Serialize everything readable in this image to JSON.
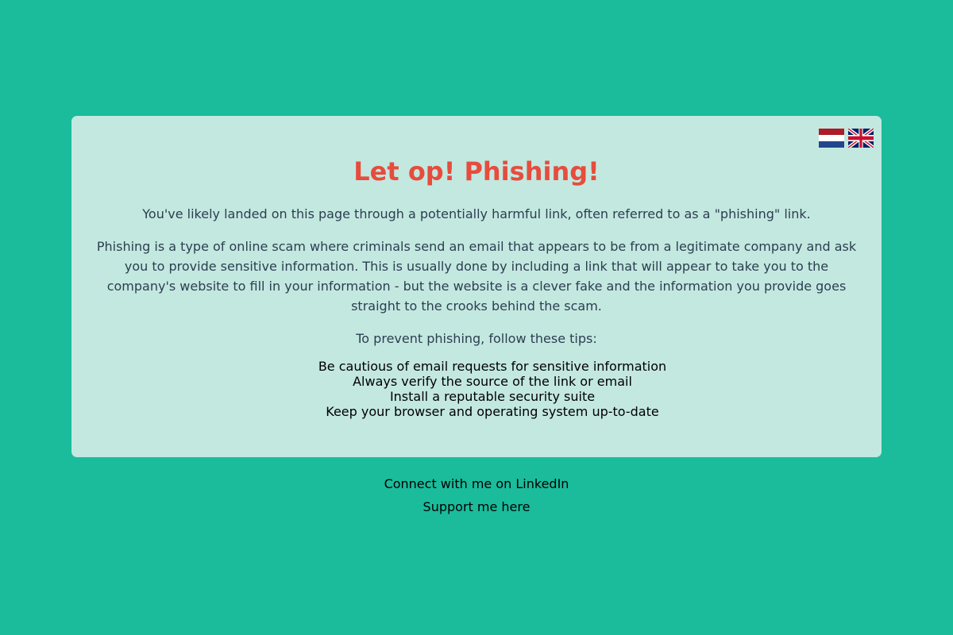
{
  "card": {
    "title": "Let op! Phishing!",
    "intro": "You've likely landed on this page through a potentially harmful link, often referred to as a \"phishing\" link.",
    "body": "Phishing is a type of online scam where criminals send an email that appears to be from a legitimate company and ask you to provide sensitive information. This is usually done by including a link that will appear to take you to the company's website to fill in your information - but the website is a clever fake and the information you provide goes straight to the crooks behind the scam.",
    "tips_heading": "To prevent phishing, follow these tips:",
    "tips": [
      "Be cautious of email requests for sensitive information",
      "Always verify the source of the link or email",
      "Install a reputable security suite",
      "Keep your browser and operating system up-to-date"
    ]
  },
  "languages": [
    {
      "icon": "netherlands-flag-icon",
      "code": "nl"
    },
    {
      "icon": "uk-flag-icon",
      "code": "en"
    }
  ],
  "footer": {
    "linkedin_label": "Connect with me on LinkedIn",
    "support_label": "Support me here"
  },
  "colors": {
    "background": "#1abc9c",
    "card": "#c3e8e0",
    "title": "#e74c3c",
    "body_text": "#2c3e50"
  }
}
